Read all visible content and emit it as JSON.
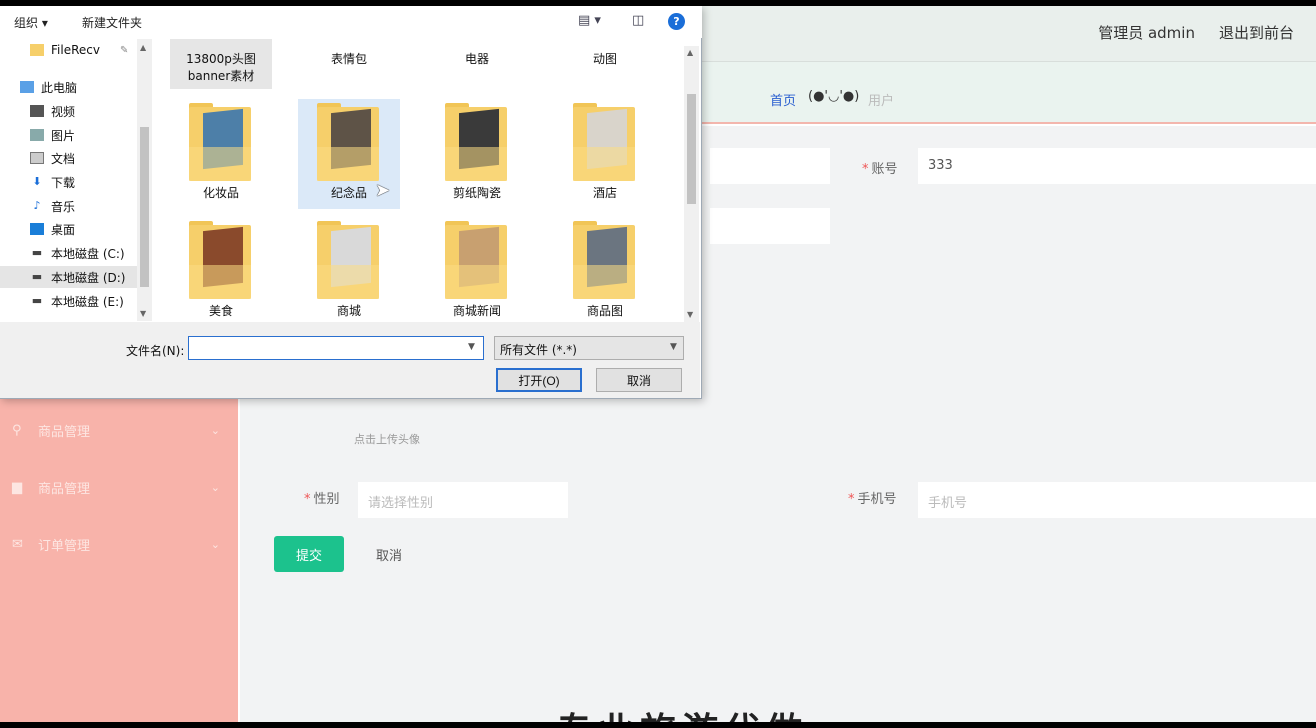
{
  "app": {
    "topbar": {
      "admin_label": "管理员 admin",
      "exit_label": "退出到前台"
    },
    "breadcrumb": {
      "home": "首页",
      "face": "(●'◡'●)",
      "current": "用户"
    },
    "sidebar": {
      "items": [
        {
          "label": "商品管理",
          "icon": "shop-icon"
        },
        {
          "label": "商品管理",
          "icon": "goods-icon"
        },
        {
          "label": "订单管理",
          "icon": "order-icon"
        }
      ]
    },
    "form": {
      "account_label": "账号",
      "account_value": "333",
      "avatar_hint": "点击上传头像",
      "gender_label": "性别",
      "gender_placeholder": "请选择性别",
      "phone_label": "手机号",
      "phone_placeholder": "手机号",
      "submit": "提交",
      "cancel": "取消"
    },
    "footer_text": "专业旅游代做"
  },
  "dialog": {
    "toolbar": {
      "organize": "组织 ▾",
      "new_folder": "新建文件夹",
      "help": "?"
    },
    "nav": [
      {
        "label": "FileRecv",
        "icon": "folder-icon"
      },
      {
        "label": "此电脑",
        "icon": "computer-icon"
      },
      {
        "label": "视频",
        "icon": "video-icon"
      },
      {
        "label": "图片",
        "icon": "picture-icon"
      },
      {
        "label": "文档",
        "icon": "document-icon"
      },
      {
        "label": "下载",
        "icon": "download-icon"
      },
      {
        "label": "音乐",
        "icon": "music-icon"
      },
      {
        "label": "桌面",
        "icon": "desktop-icon"
      },
      {
        "label": "本地磁盘 (C:)",
        "icon": "drive-icon"
      },
      {
        "label": "本地磁盘 (D:)",
        "icon": "drive-icon"
      },
      {
        "label": "本地磁盘 (E:)",
        "icon": "drive-icon"
      }
    ],
    "files": [
      {
        "label": "13800p头图 banner素材",
        "color": "#cfcfcf"
      },
      {
        "label": "表情包",
        "color": "#9fb2c4"
      },
      {
        "label": "电器",
        "color": "#8a8f9a"
      },
      {
        "label": "动图",
        "color": "#b9b1a6"
      },
      {
        "label": "化妆品",
        "color": "#4d7fa8"
      },
      {
        "label": "纪念品",
        "color": "#5e5347"
      },
      {
        "label": "剪纸陶瓷",
        "color": "#3a3a3a"
      },
      {
        "label": "酒店",
        "color": "#d9d4cb"
      },
      {
        "label": "美食",
        "color": "#8a4a2c"
      },
      {
        "label": "商城",
        "color": "#d9d9d9"
      },
      {
        "label": "商城新闻",
        "color": "#c8a070"
      },
      {
        "label": "商品图",
        "color": "#6b7580"
      }
    ],
    "filename_label": "文件名(N):",
    "filename_value": "",
    "filetype_value": "所有文件 (*.*)",
    "open_label": "打开(O)",
    "cancel_label": "取消"
  }
}
